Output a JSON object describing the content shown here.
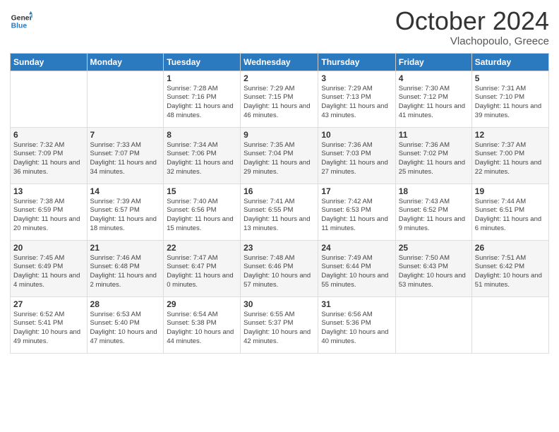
{
  "header": {
    "logo_line1": "General",
    "logo_line2": "Blue",
    "title": "October 2024",
    "subtitle": "Vlachopoulo, Greece"
  },
  "columns": [
    "Sunday",
    "Monday",
    "Tuesday",
    "Wednesday",
    "Thursday",
    "Friday",
    "Saturday"
  ],
  "weeks": [
    [
      {
        "day": "",
        "info": ""
      },
      {
        "day": "",
        "info": ""
      },
      {
        "day": "1",
        "info": "Sunrise: 7:28 AM\nSunset: 7:16 PM\nDaylight: 11 hours and 48 minutes."
      },
      {
        "day": "2",
        "info": "Sunrise: 7:29 AM\nSunset: 7:15 PM\nDaylight: 11 hours and 46 minutes."
      },
      {
        "day": "3",
        "info": "Sunrise: 7:29 AM\nSunset: 7:13 PM\nDaylight: 11 hours and 43 minutes."
      },
      {
        "day": "4",
        "info": "Sunrise: 7:30 AM\nSunset: 7:12 PM\nDaylight: 11 hours and 41 minutes."
      },
      {
        "day": "5",
        "info": "Sunrise: 7:31 AM\nSunset: 7:10 PM\nDaylight: 11 hours and 39 minutes."
      }
    ],
    [
      {
        "day": "6",
        "info": "Sunrise: 7:32 AM\nSunset: 7:09 PM\nDaylight: 11 hours and 36 minutes."
      },
      {
        "day": "7",
        "info": "Sunrise: 7:33 AM\nSunset: 7:07 PM\nDaylight: 11 hours and 34 minutes."
      },
      {
        "day": "8",
        "info": "Sunrise: 7:34 AM\nSunset: 7:06 PM\nDaylight: 11 hours and 32 minutes."
      },
      {
        "day": "9",
        "info": "Sunrise: 7:35 AM\nSunset: 7:04 PM\nDaylight: 11 hours and 29 minutes."
      },
      {
        "day": "10",
        "info": "Sunrise: 7:36 AM\nSunset: 7:03 PM\nDaylight: 11 hours and 27 minutes."
      },
      {
        "day": "11",
        "info": "Sunrise: 7:36 AM\nSunset: 7:02 PM\nDaylight: 11 hours and 25 minutes."
      },
      {
        "day": "12",
        "info": "Sunrise: 7:37 AM\nSunset: 7:00 PM\nDaylight: 11 hours and 22 minutes."
      }
    ],
    [
      {
        "day": "13",
        "info": "Sunrise: 7:38 AM\nSunset: 6:59 PM\nDaylight: 11 hours and 20 minutes."
      },
      {
        "day": "14",
        "info": "Sunrise: 7:39 AM\nSunset: 6:57 PM\nDaylight: 11 hours and 18 minutes."
      },
      {
        "day": "15",
        "info": "Sunrise: 7:40 AM\nSunset: 6:56 PM\nDaylight: 11 hours and 15 minutes."
      },
      {
        "day": "16",
        "info": "Sunrise: 7:41 AM\nSunset: 6:55 PM\nDaylight: 11 hours and 13 minutes."
      },
      {
        "day": "17",
        "info": "Sunrise: 7:42 AM\nSunset: 6:53 PM\nDaylight: 11 hours and 11 minutes."
      },
      {
        "day": "18",
        "info": "Sunrise: 7:43 AM\nSunset: 6:52 PM\nDaylight: 11 hours and 9 minutes."
      },
      {
        "day": "19",
        "info": "Sunrise: 7:44 AM\nSunset: 6:51 PM\nDaylight: 11 hours and 6 minutes."
      }
    ],
    [
      {
        "day": "20",
        "info": "Sunrise: 7:45 AM\nSunset: 6:49 PM\nDaylight: 11 hours and 4 minutes."
      },
      {
        "day": "21",
        "info": "Sunrise: 7:46 AM\nSunset: 6:48 PM\nDaylight: 11 hours and 2 minutes."
      },
      {
        "day": "22",
        "info": "Sunrise: 7:47 AM\nSunset: 6:47 PM\nDaylight: 11 hours and 0 minutes."
      },
      {
        "day": "23",
        "info": "Sunrise: 7:48 AM\nSunset: 6:46 PM\nDaylight: 10 hours and 57 minutes."
      },
      {
        "day": "24",
        "info": "Sunrise: 7:49 AM\nSunset: 6:44 PM\nDaylight: 10 hours and 55 minutes."
      },
      {
        "day": "25",
        "info": "Sunrise: 7:50 AM\nSunset: 6:43 PM\nDaylight: 10 hours and 53 minutes."
      },
      {
        "day": "26",
        "info": "Sunrise: 7:51 AM\nSunset: 6:42 PM\nDaylight: 10 hours and 51 minutes."
      }
    ],
    [
      {
        "day": "27",
        "info": "Sunrise: 6:52 AM\nSunset: 5:41 PM\nDaylight: 10 hours and 49 minutes."
      },
      {
        "day": "28",
        "info": "Sunrise: 6:53 AM\nSunset: 5:40 PM\nDaylight: 10 hours and 47 minutes."
      },
      {
        "day": "29",
        "info": "Sunrise: 6:54 AM\nSunset: 5:38 PM\nDaylight: 10 hours and 44 minutes."
      },
      {
        "day": "30",
        "info": "Sunrise: 6:55 AM\nSunset: 5:37 PM\nDaylight: 10 hours and 42 minutes."
      },
      {
        "day": "31",
        "info": "Sunrise: 6:56 AM\nSunset: 5:36 PM\nDaylight: 10 hours and 40 minutes."
      },
      {
        "day": "",
        "info": ""
      },
      {
        "day": "",
        "info": ""
      }
    ]
  ]
}
